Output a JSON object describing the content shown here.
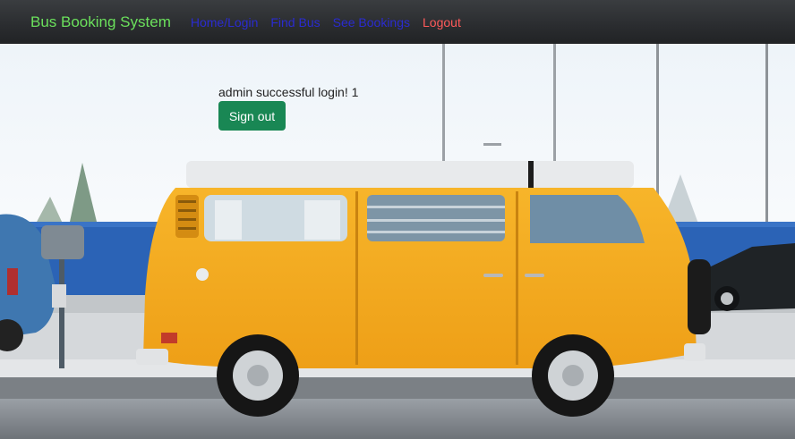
{
  "navbar": {
    "brand": "Bus Booking System",
    "links": [
      {
        "label": "Home/Login"
      },
      {
        "label": "Find Bus"
      },
      {
        "label": "See Bookings"
      },
      {
        "label": "Logout"
      }
    ]
  },
  "main": {
    "welcome_text": "admin successful login! 1",
    "signout_label": "Sign out"
  },
  "colors": {
    "brand": "#6be05c",
    "link": "#2a2bd0",
    "logout": "#ff5a5a",
    "signout_button": "#198754",
    "navbar": "#2a2c2f"
  },
  "background": {
    "icon": "orange-van-photo"
  }
}
